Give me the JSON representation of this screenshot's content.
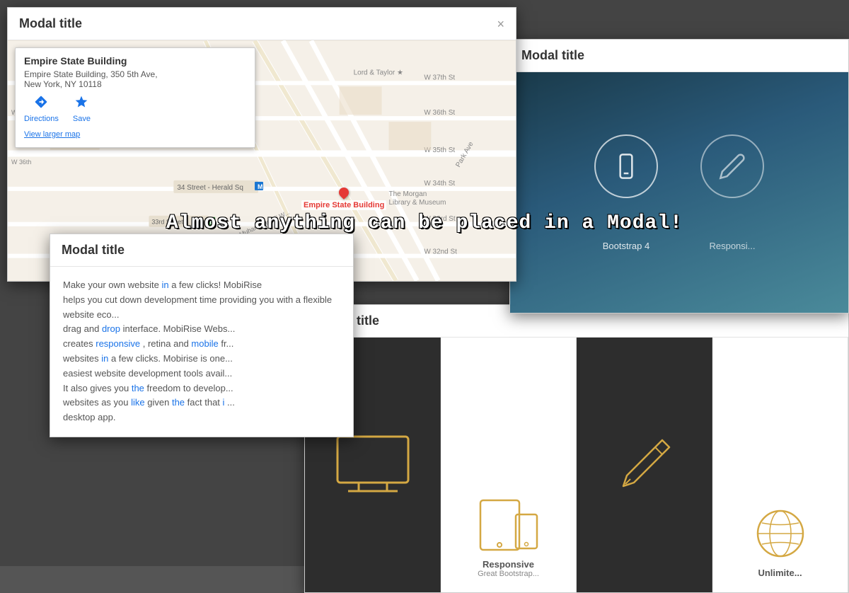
{
  "modals": {
    "modal1": {
      "title": "Modal title",
      "close_label": "×",
      "map": {
        "popup": {
          "title": "Empire State Building",
          "address": "Empire State Building, 350 5th Ave,\nNew York, NY 10118",
          "actions": [
            {
              "label": "Directions",
              "icon": "directions"
            },
            {
              "label": "Save",
              "icon": "star"
            }
          ],
          "view_larger": "View larger map"
        },
        "pin_label": "Empire State Building"
      }
    },
    "modal2": {
      "title": "Modal title",
      "features": [
        {
          "label": "Bootstrap 4",
          "icon": "mobile"
        },
        {
          "label": "Responsi...",
          "icon": "pencil"
        }
      ]
    },
    "modal3": {
      "title": "Modal title",
      "body_text": "Make your own website in a few clicks! MobiRise helps you cut down development time by providing you with a flexible website eco... drag and drop interface. MobiRise Website creates responsive, retina and mobile fr... websites in a few clicks. Mobirise is one... easiest website development tools avail... It also gives you the freedom to develop... websites as you like given the fact that i... desktop app."
    },
    "modal4": {
      "title": "Modal title",
      "cards": [
        {
          "label": "",
          "sublabel": "",
          "type": "monitor-dark"
        },
        {
          "label": "Responsive",
          "sublabel": "Great Bootstrap...",
          "type": "responsive-light"
        },
        {
          "label": "",
          "sublabel": "",
          "type": "pencil-dark"
        },
        {
          "label": "Unlimite...",
          "sublabel": "",
          "type": "globe-light"
        }
      ]
    }
  },
  "overlay_text": "Almost anything can be placed in a Modal!",
  "colors": {
    "accent_blue": "#1a73e8",
    "accent_gold": "#d4a843",
    "modal_header_bg": "#ffffff",
    "modal_border": "#cccccc",
    "dark_card_bg": "#2d2d2d",
    "map_bg": "#f5f0e8"
  }
}
